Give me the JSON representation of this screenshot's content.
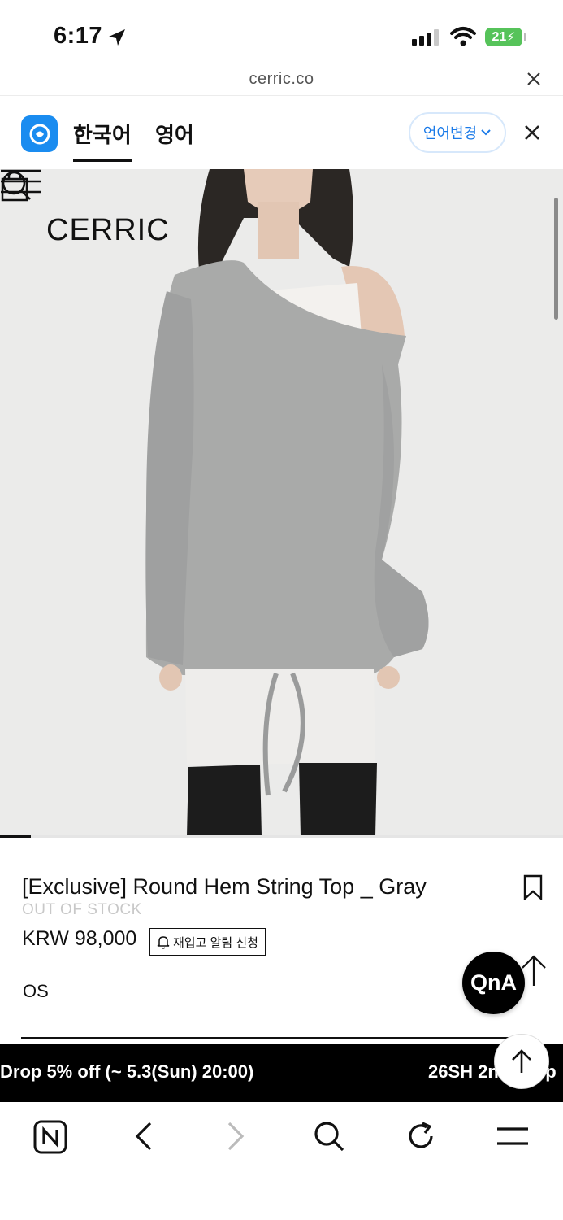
{
  "status_bar": {
    "time": "6:17",
    "battery": "21"
  },
  "url_bar": {
    "url": "cerric.co"
  },
  "translate_bar": {
    "tab_korean": "한국어",
    "tab_english": "영어",
    "change_language": "언어변경"
  },
  "site": {
    "brand": "CERRIC"
  },
  "product": {
    "title": "[Exclusive] Round Hem String Top _ Gray",
    "stock_status": "OUT OF STOCK",
    "price": "KRW 98,000",
    "restock_alert": "재입고 알림 신청",
    "option": "OS"
  },
  "floating": {
    "qna": "QnA"
  },
  "banner": {
    "text_1": "Drop 5% off (~ 5.3(Sun) 20:00)",
    "text_2": "26SH 2nd Drop"
  },
  "colors": {
    "accent_blue": "#1a8cf0",
    "battery_green": "#56c35a",
    "banner_bg": "#000000"
  },
  "icons": [
    "location-arrow-icon",
    "signal-icon",
    "wifi-icon",
    "close-icon",
    "papago-logo-icon",
    "chevron-down-icon",
    "shopping-bag-icon",
    "search-icon",
    "menu-icon",
    "bookmark-icon",
    "bell-icon",
    "arrow-up-icon",
    "naver-icon",
    "back-icon",
    "forward-icon",
    "refresh-icon"
  ]
}
